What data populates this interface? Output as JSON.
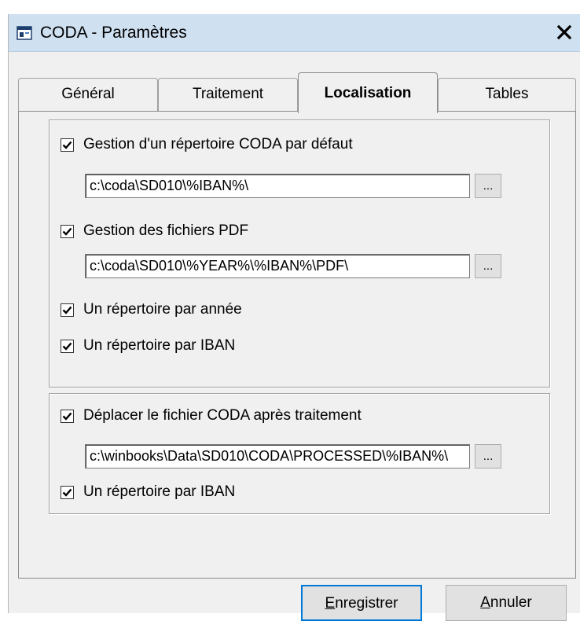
{
  "window": {
    "title": "CODA - Paramètres",
    "close_glyph": "✕"
  },
  "tabs": [
    {
      "label": "Général",
      "active": false
    },
    {
      "label": "Traitement",
      "active": false
    },
    {
      "label": "Localisation",
      "active": true
    },
    {
      "label": "Tables",
      "active": false
    }
  ],
  "group1": {
    "default_dir": {
      "label": "Gestion d'un répertoire CODA par défaut",
      "checked": true,
      "path": "c:\\coda\\SD010\\%IBAN%\\"
    },
    "pdf_files": {
      "label": "Gestion des fichiers PDF",
      "checked": true,
      "path": "c:\\coda\\SD010\\%YEAR%\\%IBAN%\\PDF\\"
    },
    "dir_per_year": {
      "label": "Un répertoire par année",
      "checked": true
    },
    "dir_per_iban": {
      "label": "Un répertoire par IBAN",
      "checked": true
    }
  },
  "group2": {
    "move_after": {
      "label": "Déplacer le fichier CODA après traitement",
      "checked": true,
      "path": "c:\\winbooks\\Data\\SD010\\CODA\\PROCESSED\\%IBAN%\\"
    },
    "dir_per_iban": {
      "label": "Un répertoire par IBAN",
      "checked": true
    }
  },
  "browse_label": "...",
  "footer": {
    "save": {
      "first_letter": "E",
      "rest": "nregistrer"
    },
    "cancel": {
      "first_letter": "A",
      "rest": "nnuler"
    }
  },
  "icons": {
    "app": "app-window-icon",
    "check": "checkmark-icon",
    "close": "close-icon"
  },
  "colors": {
    "titlebar": "#cfe0f1",
    "window_bg": "#f0f0f0",
    "default_button_border": "#0078d7"
  }
}
